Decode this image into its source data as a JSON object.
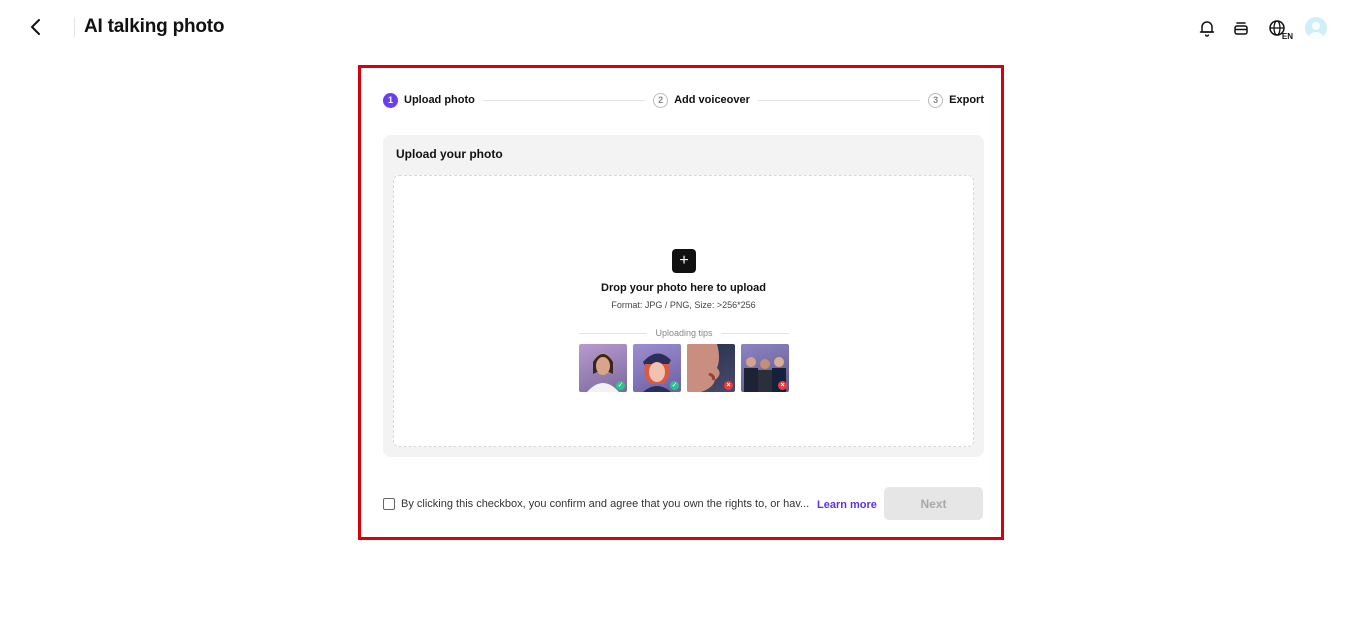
{
  "header": {
    "title": "AI talking photo",
    "language_code": "EN",
    "icons": [
      "chevron-left-icon",
      "bell-icon",
      "wallet-icon",
      "globe-icon",
      "avatar"
    ]
  },
  "stepper": {
    "steps": [
      {
        "number": "1",
        "label": "Upload photo",
        "state": "active"
      },
      {
        "number": "2",
        "label": "Add voiceover",
        "state": "inactive"
      },
      {
        "number": "3",
        "label": "Export",
        "state": "inactive"
      }
    ]
  },
  "upload": {
    "card_title": "Upload your photo",
    "drop_text": "Drop your photo here to upload",
    "format_text": "Format: JPG / PNG, Size: >256*256",
    "tips_label": "Uploading tips",
    "tips": [
      {
        "name": "tip-single-face-front",
        "status": "good"
      },
      {
        "name": "tip-illustrated-face",
        "status": "good"
      },
      {
        "name": "tip-face-side-profile",
        "status": "bad"
      },
      {
        "name": "tip-multiple-people",
        "status": "bad"
      }
    ]
  },
  "footer": {
    "consent_text": "By clicking this checkbox, you confirm and agree that you own the rights to, or hav...",
    "learn_more": "Learn more",
    "next_label": "Next"
  },
  "colors": {
    "accent": "#6a3df0",
    "link": "#5b32e6",
    "highlight_border": "#d9000d",
    "good": "#2ec38a",
    "bad": "#ee3b3b"
  }
}
